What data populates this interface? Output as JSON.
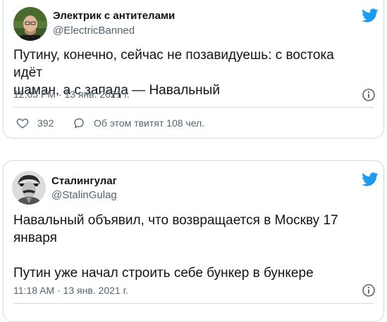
{
  "tweets": [
    {
      "author_name": "Электрик с антителами",
      "author_handle": "@ElectricBanned",
      "text_lines": [
        "Путину, конечно, сейчас не позавидуешь: с востока идёт",
        "шаман, а с запада — Навальный"
      ],
      "time": "12:05 PM · 13 янв. 2021 г.",
      "likes": "392",
      "retweet_text": "Об этом твитят 108 чел."
    },
    {
      "author_name": "Сталингулаг",
      "author_handle": "@StalinGulag",
      "text_lines": [
        "Навальный объявил, что возвращается в Москву 17",
        "января"
      ],
      "text_line3": "Путин уже начал строить себе бункер в бункере",
      "time": "11:18 AM · 13 янв. 2021 г."
    }
  ],
  "colors": {
    "twitter_blue": "#1d9bf0",
    "secondary_text": "#536471",
    "border": "#cfd9de"
  },
  "icons": [
    "twitter-bird-icon",
    "info-icon",
    "heart-icon",
    "comment-icon"
  ]
}
